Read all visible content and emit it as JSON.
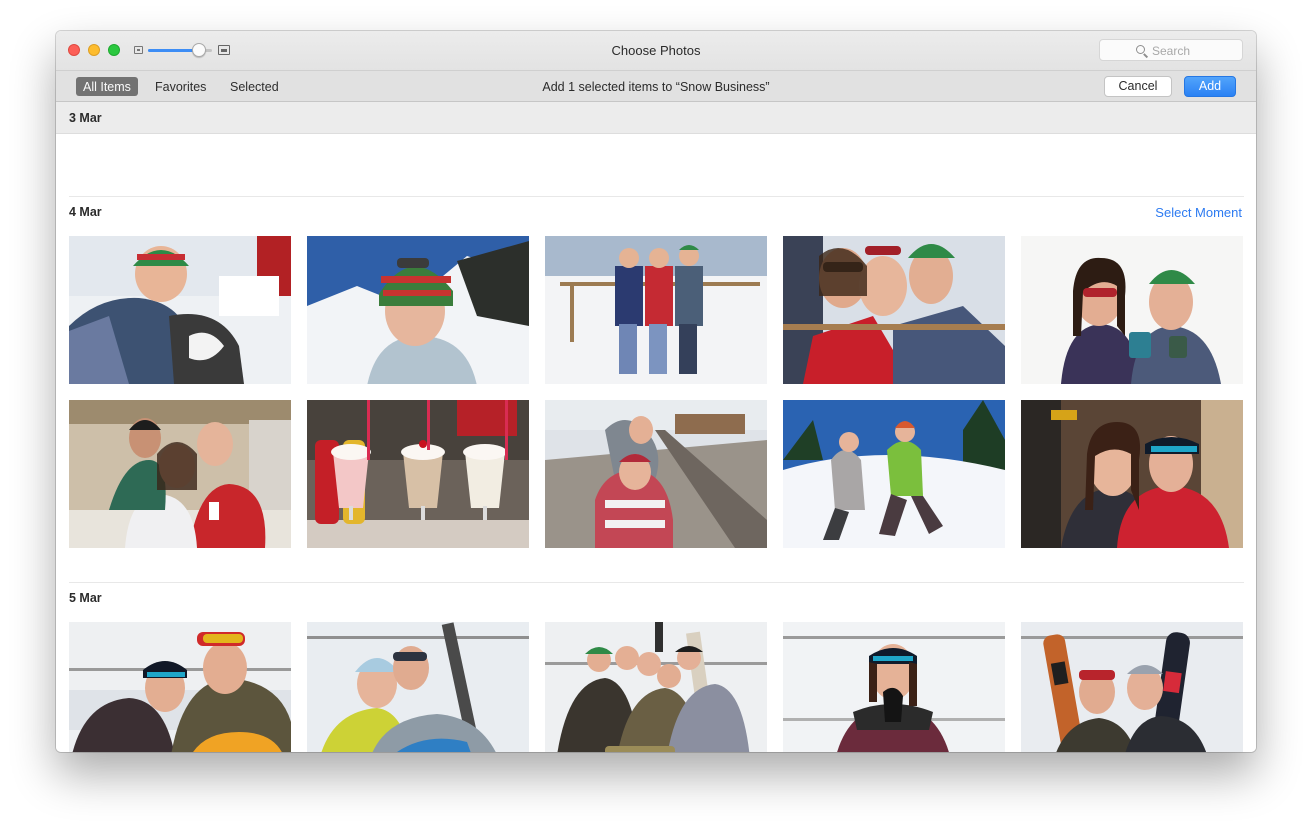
{
  "window": {
    "title": "Choose Photos",
    "search_placeholder": "Search",
    "zoom_level": 0.8
  },
  "toolbar": {
    "tabs": [
      {
        "label": "All Items",
        "selected": true
      },
      {
        "label": "Favorites",
        "selected": false
      },
      {
        "label": "Selected",
        "selected": false
      }
    ],
    "message": "Add 1 selected items to “Snow Business”",
    "cancel_label": "Cancel",
    "add_label": "Add"
  },
  "colors": {
    "accent": "#2d7bf1",
    "selected_tab": "#727272"
  },
  "moments": [
    {
      "date": "3 Mar",
      "photos": []
    },
    {
      "date": "4 Mar",
      "action": "Select Moment",
      "photos": [
        {
          "icon": "photo-girl-with-husky"
        },
        {
          "icon": "photo-portrait-mountains"
        },
        {
          "icon": "photo-three-friends-railing"
        },
        {
          "icon": "photo-friends-sunglasses"
        },
        {
          "icon": "photo-friends-mugs"
        },
        {
          "icon": "photo-diner-friends"
        },
        {
          "icon": "photo-milkshakes"
        },
        {
          "icon": "photo-railroad-tracks"
        },
        {
          "icon": "photo-snow-running"
        },
        {
          "icon": "photo-hug-portrait"
        }
      ]
    },
    {
      "date": "5 Mar",
      "photos": [
        {
          "icon": "photo-gondola-pair"
        },
        {
          "icon": "photo-gondola-snowboard"
        },
        {
          "icon": "photo-gondola-group"
        },
        {
          "icon": "photo-gondola-smile"
        },
        {
          "icon": "photo-gondola-boards"
        }
      ]
    }
  ]
}
